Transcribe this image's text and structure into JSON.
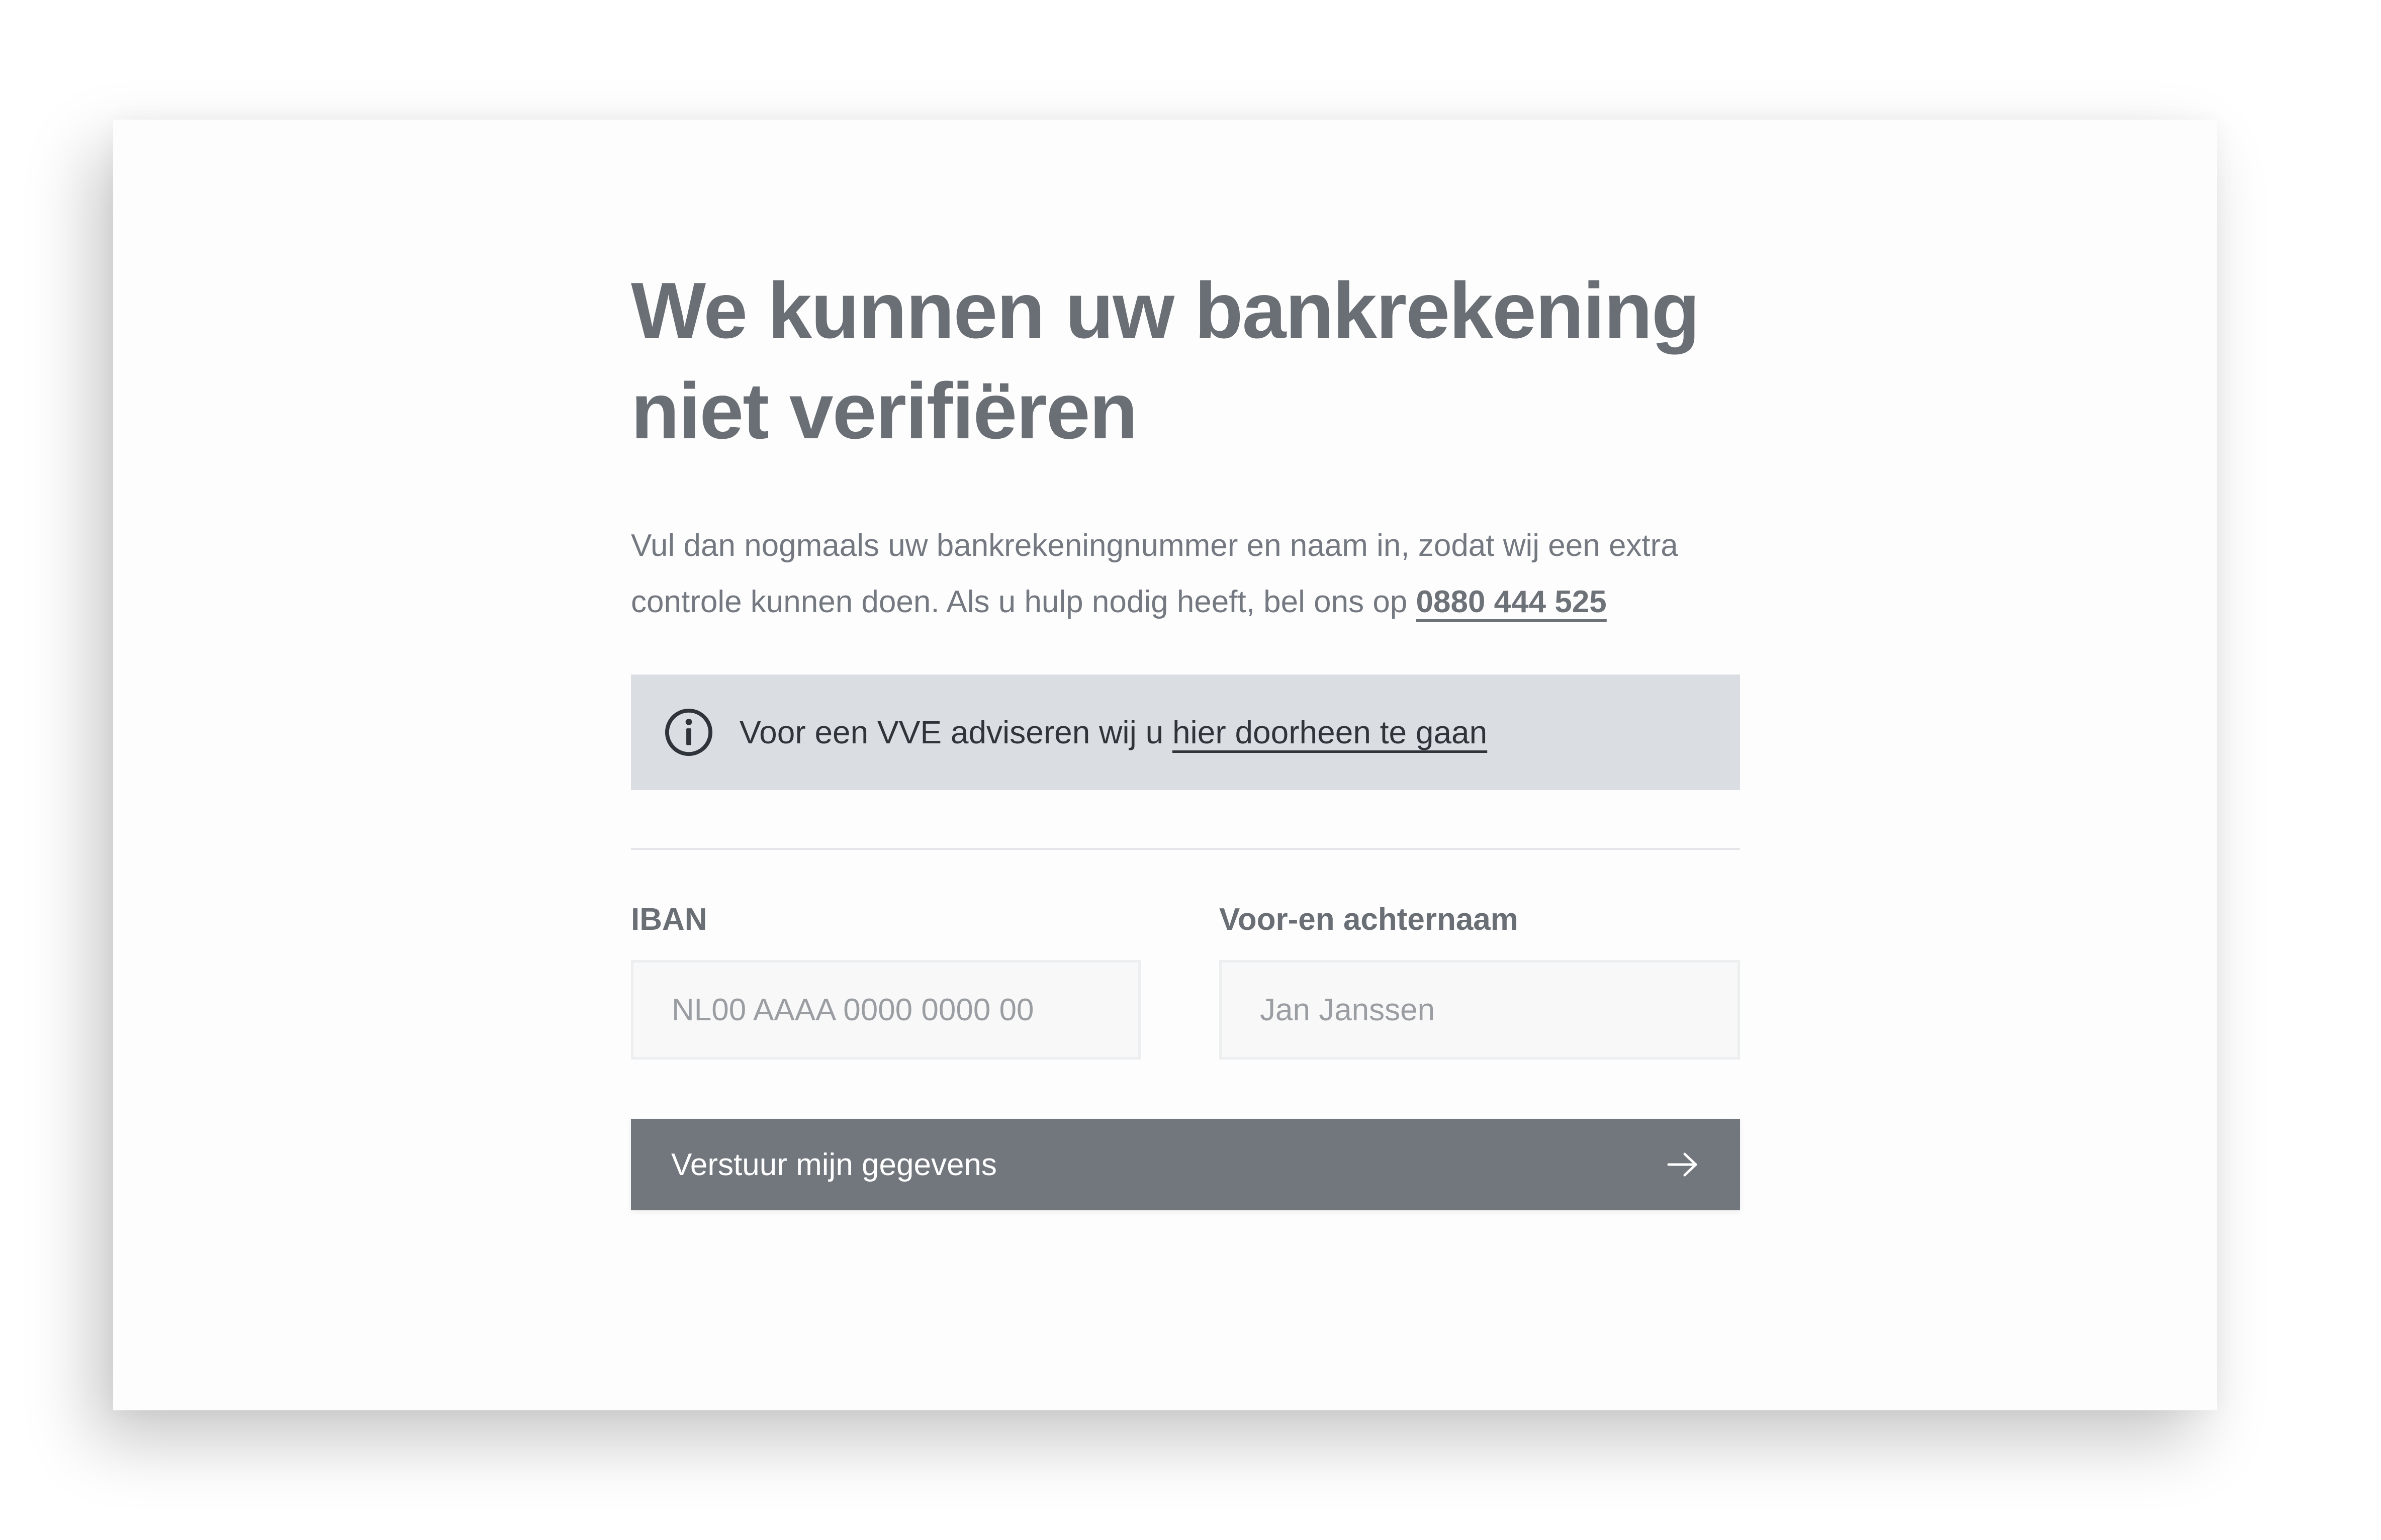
{
  "page": {
    "title": "We kunnen uw bankrekening niet verifiëren",
    "intro_text": "Vul dan nogmaals uw bankrekeningnummer en naam in, zodat wij een extra controle kunnen doen. Als u hulp nodig heeft, bel ons op ",
    "phone_link": "0880 444 525"
  },
  "notice": {
    "icon": "info-icon",
    "text": "Voor een VVE adviseren wij u ",
    "link_text": "hier doorheen te gaan"
  },
  "form": {
    "iban": {
      "label": "IBAN",
      "placeholder": "NL00 AAAA 0000 0000 00",
      "value": ""
    },
    "name": {
      "label": "Voor-en achternaam",
      "placeholder": "Jan Janssen",
      "value": ""
    },
    "submit": {
      "label": "Verstuur mijn gegevens",
      "icon": "arrow-right-icon"
    }
  },
  "colors": {
    "heading": "#6a6f76",
    "notice_bg": "#dadee2",
    "button_bg": "#72777e"
  }
}
